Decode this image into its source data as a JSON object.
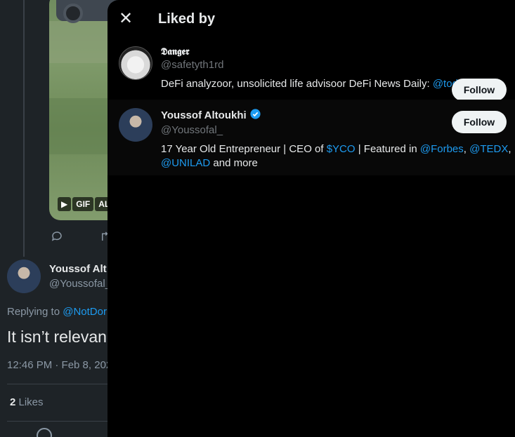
{
  "background": {
    "gif_badges": [
      "▶",
      "GIF",
      "AL"
    ],
    "action_icons": [
      "reply-icon",
      "retweet-icon"
    ],
    "author": {
      "name": "Youssof Alt",
      "handle": "@Youssofal_"
    },
    "replying_prefix": "Replying to ",
    "replying_mention": "@NotDor",
    "tweet_text": "It isn’t relevan",
    "timestamp": "12:46 PM · Feb 8, 202",
    "likes_count": "2",
    "likes_label": " Likes"
  },
  "modal": {
    "close_symbol": "✕",
    "title": "Liked by",
    "users": [
      {
        "name": "𝕯𝖆𝖓𝖌𝖊𝖗",
        "handle": "@safetyth1rd",
        "verified": false,
        "follow_label": "Follow",
        "bio": [
          {
            "text": "DeFi analyzoor, unsolicited life advisoor DeFi News Daily: ",
            "link": false
          },
          {
            "text": "@todayindefi",
            "link": true
          }
        ]
      },
      {
        "name": "Youssof Altoukhi",
        "handle": "@Youssofal_",
        "verified": true,
        "follow_label": "Follow",
        "bio": [
          {
            "text": "17 Year Old Entrepreneur | CEO of ",
            "link": false
          },
          {
            "text": "$YCO",
            "link": true
          },
          {
            "text": " | Featured in ",
            "link": false
          },
          {
            "text": "@Forbes",
            "link": true
          },
          {
            "text": ", ",
            "link": false
          },
          {
            "text": "@TEDX",
            "link": true
          },
          {
            "text": ", ",
            "link": false
          },
          {
            "text": "@UNILAD",
            "link": true
          },
          {
            "text": " and more",
            "link": false
          }
        ]
      }
    ]
  },
  "colors": {
    "accent": "#1d9bf0",
    "modal_bg": "#000000",
    "page_bg": "#1e2327",
    "muted_text": "#71767b",
    "follow_button_bg": "#eff3f4"
  }
}
